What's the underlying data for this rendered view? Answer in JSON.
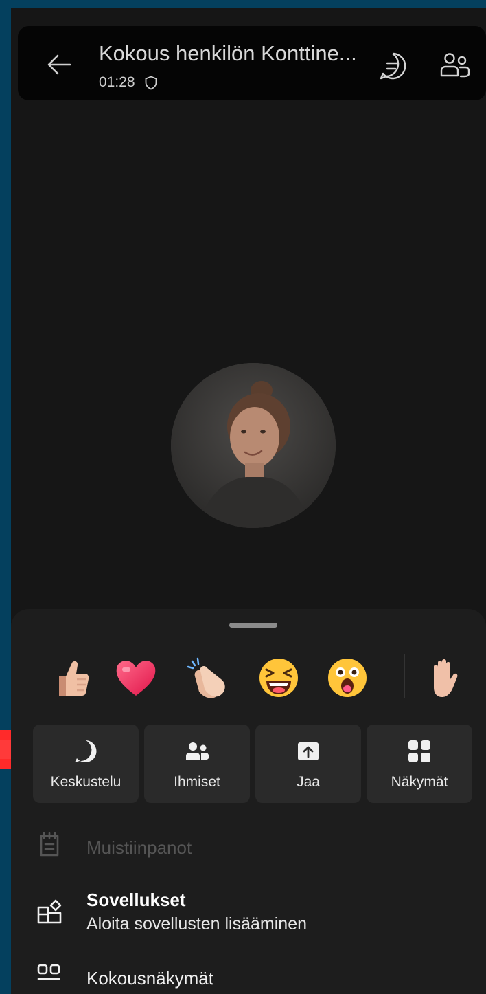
{
  "header": {
    "title": "Kokous henkilön Konttine...",
    "timer": "01:28",
    "back_icon": "arrow-left-icon",
    "chat_icon": "chat-icon",
    "people_icon": "people-icon"
  },
  "reactions": {
    "items": [
      {
        "name": "thumbs-up",
        "emoji": "👍"
      },
      {
        "name": "heart",
        "emoji": "❤️"
      },
      {
        "name": "applause",
        "emoji": "👏"
      },
      {
        "name": "laugh",
        "emoji": "😆"
      },
      {
        "name": "surprised",
        "emoji": "😮"
      }
    ],
    "raise_hand": {
      "name": "raise-hand",
      "emoji": "✋"
    }
  },
  "actions": {
    "items": [
      {
        "label": "Keskustelu",
        "icon": "chat-bubble-icon"
      },
      {
        "label": "Ihmiset",
        "icon": "people-icon"
      },
      {
        "label": "Jaa",
        "icon": "share-upload-icon"
      },
      {
        "label": "Näkymät",
        "icon": "grid-icon"
      }
    ]
  },
  "menu": {
    "notes": {
      "label": "Muistiinpanot",
      "icon": "notes-icon",
      "disabled": true
    },
    "apps": {
      "label": "Sovellukset",
      "description": "Aloita sovellusten lisääminen",
      "icon": "apps-add-icon"
    },
    "views": {
      "label": "Kokousnäkymät",
      "icon": "meeting-views-icon"
    }
  },
  "colors": {
    "frame": "#04405e",
    "background": "#161616",
    "sheet": "#1d1d1d",
    "button": "#2a2a2a",
    "accent_arrow": "#ff2a2a"
  }
}
